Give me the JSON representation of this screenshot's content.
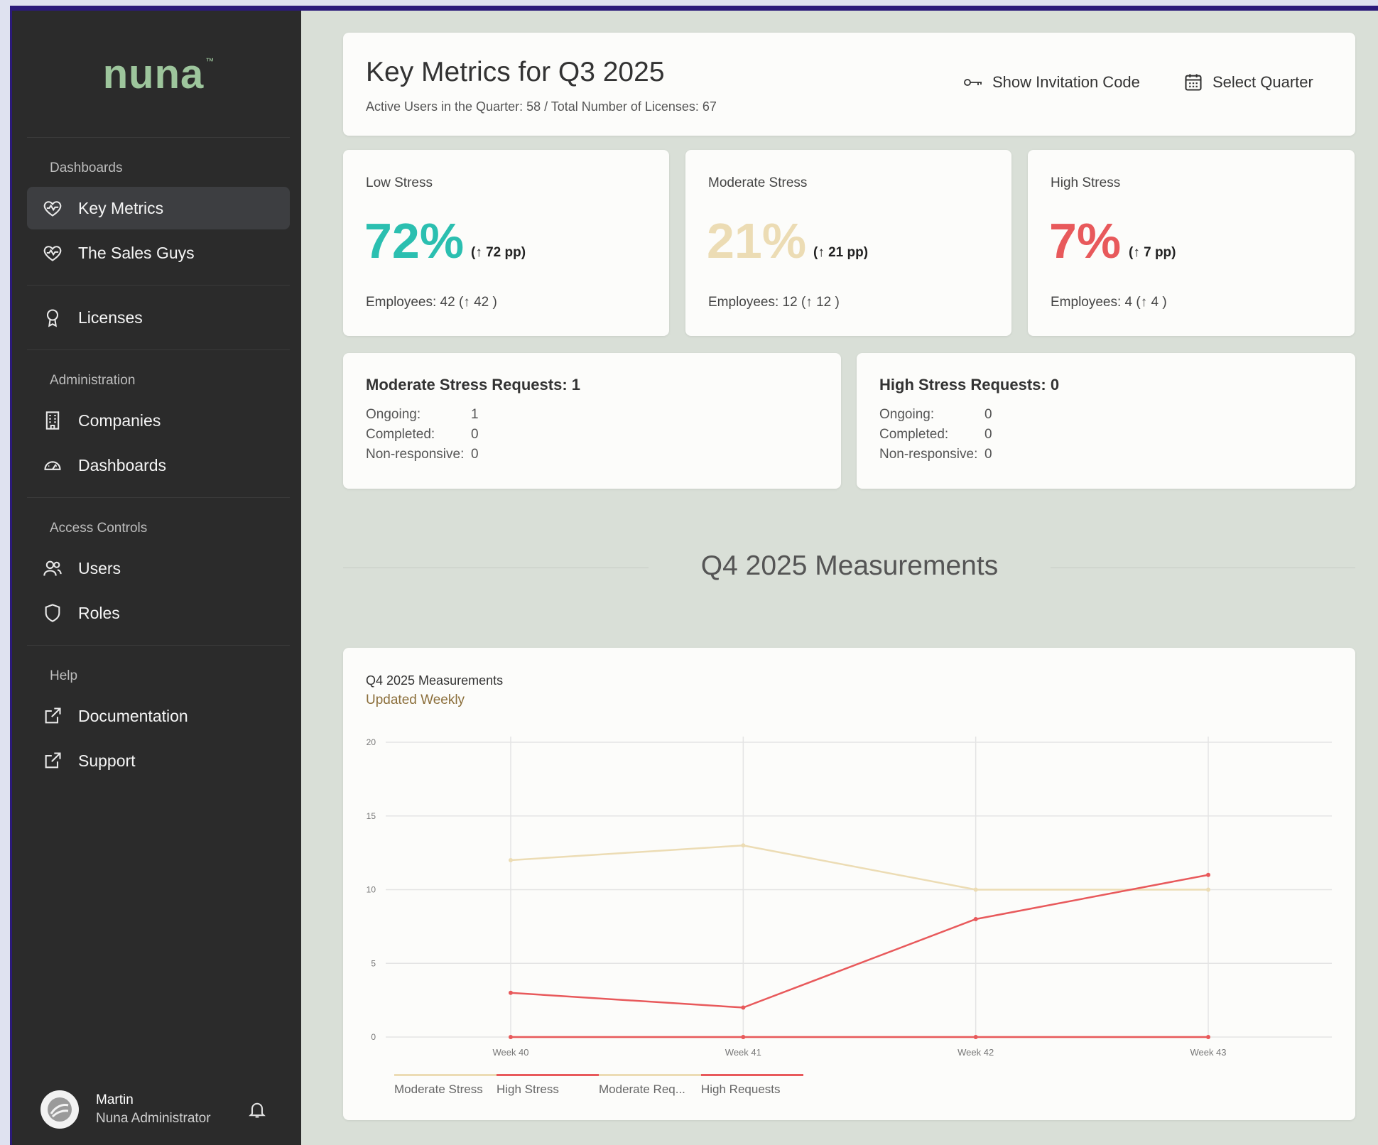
{
  "brand": {
    "logo": "nuna",
    "tm": "™"
  },
  "sidebar": {
    "sections": [
      {
        "title": "Dashboards"
      },
      {
        "title": "Administration"
      },
      {
        "title": "Access Controls"
      },
      {
        "title": "Help"
      }
    ],
    "items": {
      "key_metrics": "Key Metrics",
      "sales_guys": "The Sales Guys",
      "licenses": "Licenses",
      "companies": "Companies",
      "dashboards": "Dashboards",
      "users": "Users",
      "roles": "Roles",
      "documentation": "Documentation",
      "support": "Support"
    },
    "user": {
      "name": "Martin",
      "role": "Nuna Administrator"
    }
  },
  "header": {
    "title": "Key Metrics for Q3 2025",
    "subtitle": "Active Users in the Quarter: 58 / Total Number of Licenses: 67",
    "invite_label": "Show Invitation Code",
    "quarter_label": "Select Quarter"
  },
  "stats": [
    {
      "label": "Low Stress",
      "value": "72%",
      "delta": "(↑ 72 pp)",
      "employees": "Employees: 42  (↑ 42 )",
      "color": "#2bbfb0"
    },
    {
      "label": "Moderate Stress",
      "value": "21%",
      "delta": "(↑ 21 pp)",
      "employees": "Employees: 12  (↑ 12 )",
      "color": "#ecdcb4"
    },
    {
      "label": "High Stress",
      "value": "7%",
      "delta": "(↑ 7 pp)",
      "employees": "Employees: 4  (↑ 4 )",
      "color": "#e8595b"
    }
  ],
  "requests": [
    {
      "title": "Moderate Stress Requests: 1",
      "ongoing_label": "Ongoing:",
      "ongoing": "1",
      "completed_label": "Completed:",
      "completed": "0",
      "nonresp_label": "Non-responsive:",
      "nonresp": "0"
    },
    {
      "title": "High Stress Requests: 0",
      "ongoing_label": "Ongoing:",
      "ongoing": "0",
      "completed_label": "Completed:",
      "completed": "0",
      "nonresp_label": "Non-responsive:",
      "nonresp": "0"
    }
  ],
  "section_heading": "Q4 2025 Measurements",
  "chart_data": {
    "type": "line",
    "title": "Q4 2025 Measurements",
    "subtitle": "Updated Weekly",
    "x": [
      "Week 40",
      "Week 41",
      "Week 42",
      "Week 43"
    ],
    "ylim": [
      0,
      20
    ],
    "yticks": [
      0,
      5,
      10,
      15,
      20
    ],
    "grid": true,
    "legend_position": "bottom-left",
    "series": [
      {
        "name": "Moderate Stress",
        "values": [
          12,
          13,
          10,
          10
        ],
        "color": "#ecdcb4"
      },
      {
        "name": "High Stress",
        "values": [
          3,
          2,
          8,
          11
        ],
        "color": "#e8595b"
      },
      {
        "name": "Moderate Req...",
        "values": [
          0,
          0,
          0,
          0
        ],
        "color": "#ecdcb4"
      },
      {
        "name": "High Requests",
        "values": [
          0,
          0,
          0,
          0
        ],
        "color": "#e8595b"
      }
    ]
  }
}
